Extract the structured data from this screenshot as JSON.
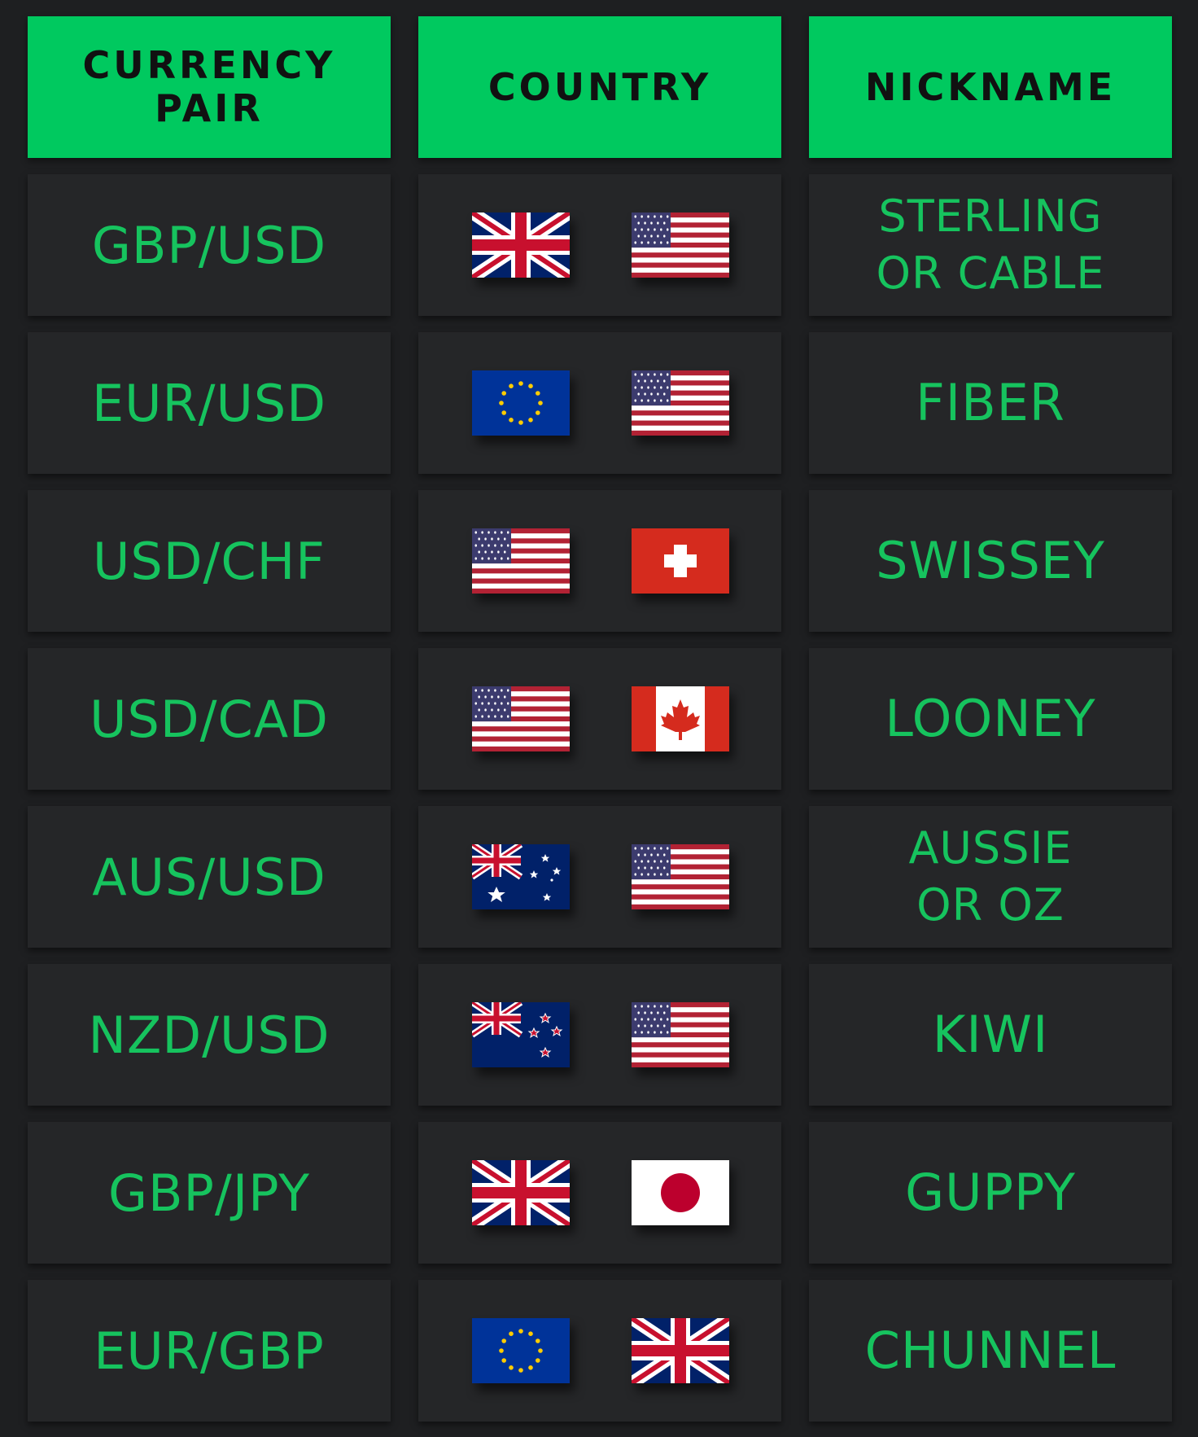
{
  "headers": [
    "CURRENCY\nPAIR",
    "COUNTRY",
    "NICKNAME"
  ],
  "rows": [
    {
      "pair": "GBP/USD",
      "flags": [
        "uk-flag-icon",
        "us-flag-icon"
      ],
      "nickname": "STERLING\nOR CABLE"
    },
    {
      "pair": "EUR/USD",
      "flags": [
        "eu-flag-icon",
        "us-flag-icon"
      ],
      "nickname": "FIBER"
    },
    {
      "pair": "USD/CHF",
      "flags": [
        "us-flag-icon",
        "swiss-flag-icon"
      ],
      "nickname": "SWISSEY"
    },
    {
      "pair": "USD/CAD",
      "flags": [
        "us-flag-icon",
        "canada-flag-icon"
      ],
      "nickname": "LOONEY"
    },
    {
      "pair": "AUS/USD",
      "flags": [
        "australia-flag-icon",
        "us-flag-icon"
      ],
      "nickname": "AUSSIE\nOR OZ"
    },
    {
      "pair": "NZD/USD",
      "flags": [
        "new-zealand-flag-icon",
        "us-flag-icon"
      ],
      "nickname": "KIWI"
    },
    {
      "pair": "GBP/JPY",
      "flags": [
        "uk-flag-icon",
        "japan-flag-icon"
      ],
      "nickname": "GUPPY"
    },
    {
      "pair": "EUR/GBP",
      "flags": [
        "eu-flag-icon",
        "uk-flag-icon"
      ],
      "nickname": "CHUNNEL"
    }
  ],
  "colors": {
    "accent": "#00c95f",
    "text_green": "#16c35e",
    "cell_bg": "#252628",
    "page_bg": "#1e1f21"
  }
}
